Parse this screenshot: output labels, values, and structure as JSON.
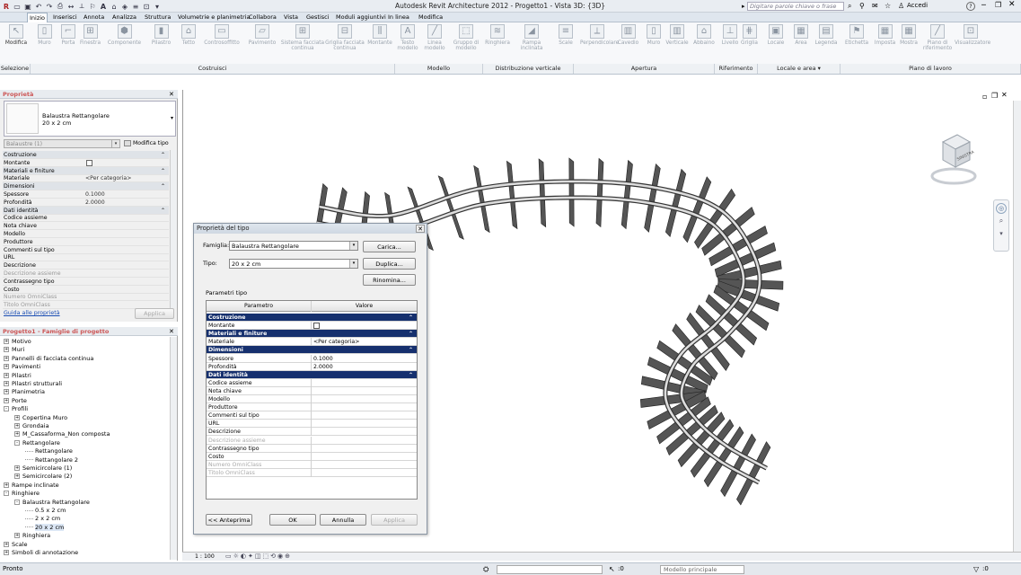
{
  "window": {
    "title": "Autodesk Revit Architecture 2012 -     Progetto1 - Vista 3D: {3D}",
    "search_placeholder": "Digitare parole chiave o frase",
    "signin": "Accedi",
    "help": "?"
  },
  "tabs": [
    "Inizio",
    "Inserisci",
    "Annota",
    "Analizza",
    "Struttura",
    "Volumetrie e planimetria",
    "Collabora",
    "Vista",
    "Gestisci",
    "Moduli aggiuntivi",
    "In linea",
    "Modifica"
  ],
  "active_tab": "Inizio",
  "ribbon": {
    "buttons": [
      "Modifica",
      "Muro",
      "Porta",
      "Finestra",
      "Componente",
      "Pilastro",
      "Tetto",
      "Controsoffitto",
      "Pavimento",
      "Sistema facciata continua",
      "Griglia facciata continua",
      "Montante",
      "Testo modello",
      "Linea modello",
      "Gruppo di modello",
      "Ringhiera",
      "Rampa inclinata",
      "Scale",
      "Perpendicolare",
      "Cavedio",
      "Muro",
      "Verticale",
      "Abbaino",
      "Livello",
      "Griglia",
      "Locale",
      "Area",
      "Legenda",
      "Etichetta",
      "Imposta",
      "Mostra",
      "Piano di riferimento",
      "Visualizzatore"
    ],
    "panels": [
      "Selezione",
      "Costruisci",
      "Modello",
      "Distribuzione verticale",
      "Apertura",
      "Riferimento",
      "Locale e area ▾",
      "Piano di lavoro"
    ]
  },
  "properties": {
    "header": "Proprietà",
    "type_name_line1": "Balaustra Rettangolare",
    "type_name_line2": "20 x 2 cm",
    "filter": "Balaustre (1)",
    "edit_type": "Modifica tipo",
    "rows": [
      {
        "k": "Costruzione",
        "v": "",
        "grp": true
      },
      {
        "k": "Montante",
        "v": "",
        "check": true
      },
      {
        "k": "Materiali e finiture",
        "v": "",
        "grp": true
      },
      {
        "k": "Materiale",
        "v": "<Per categoria>"
      },
      {
        "k": "Dimensioni",
        "v": "",
        "grp": true
      },
      {
        "k": "Spessore",
        "v": "0.1000"
      },
      {
        "k": "Profondità",
        "v": "2.0000"
      },
      {
        "k": "Dati identità",
        "v": "",
        "grp": true
      },
      {
        "k": "Codice assieme",
        "v": ""
      },
      {
        "k": "Nota chiave",
        "v": ""
      },
      {
        "k": "Modello",
        "v": ""
      },
      {
        "k": "Produttore",
        "v": ""
      },
      {
        "k": "Commenti sul tipo",
        "v": ""
      },
      {
        "k": "URL",
        "v": ""
      },
      {
        "k": "Descrizione",
        "v": ""
      },
      {
        "k": "Descrizione assieme",
        "v": "",
        "dim": true
      },
      {
        "k": "Contrassegno tipo",
        "v": ""
      },
      {
        "k": "Costo",
        "v": ""
      },
      {
        "k": "Numero OmniClass",
        "v": "",
        "dim": true
      },
      {
        "k": "Titolo OmniClass",
        "v": "",
        "dim": true
      }
    ],
    "help_link": "Guida alle proprietà",
    "apply": "Applica"
  },
  "browser": {
    "header": "Progetto1 - Famiglie di progetto",
    "nodes": [
      {
        "t": "Motivo",
        "d": 1,
        "tog": "+"
      },
      {
        "t": "Muri",
        "d": 1,
        "tog": "+"
      },
      {
        "t": "Pannelli di facciata continua",
        "d": 1,
        "tog": "+"
      },
      {
        "t": "Pavimenti",
        "d": 1,
        "tog": "+"
      },
      {
        "t": "Pilastri",
        "d": 1,
        "tog": "+"
      },
      {
        "t": "Pilastri strutturali",
        "d": 1,
        "tog": "+"
      },
      {
        "t": "Planimetria",
        "d": 1,
        "tog": "+"
      },
      {
        "t": "Porte",
        "d": 1,
        "tog": "+"
      },
      {
        "t": "Profili",
        "d": 1,
        "tog": "-"
      },
      {
        "t": "Copertina Muro",
        "d": 2,
        "tog": "+"
      },
      {
        "t": "Grondaia",
        "d": 2,
        "tog": "+"
      },
      {
        "t": "M_Cassaforma_Non composta",
        "d": 2,
        "tog": "+"
      },
      {
        "t": "Rettangolare",
        "d": 2,
        "tog": "-"
      },
      {
        "t": "Rettangolare",
        "d": 3,
        "tog": ""
      },
      {
        "t": "Rettangolare 2",
        "d": 3,
        "tog": ""
      },
      {
        "t": "Semicircolare (1)",
        "d": 2,
        "tog": "+"
      },
      {
        "t": "Semicircolare (2)",
        "d": 2,
        "tog": "+"
      },
      {
        "t": "Rampe inclinate",
        "d": 1,
        "tog": "+"
      },
      {
        "t": "Ringhiere",
        "d": 1,
        "tog": "-"
      },
      {
        "t": "Balaustra Rettangolare",
        "d": 2,
        "tog": "-"
      },
      {
        "t": "0.5 x 2 cm",
        "d": 3,
        "tog": ""
      },
      {
        "t": "2 x 2 cm",
        "d": 3,
        "tog": ""
      },
      {
        "t": "20 x 2 cm",
        "d": 3,
        "tog": "",
        "sel": true
      },
      {
        "t": "Ringhiera",
        "d": 2,
        "tog": "+"
      },
      {
        "t": "Scale",
        "d": 1,
        "tog": "+"
      },
      {
        "t": "Simboli di annotazione",
        "d": 1,
        "tog": "+"
      }
    ]
  },
  "dialog": {
    "title": "Proprietà del tipo",
    "family_label": "Famiglia:",
    "family_value": "Balaustra Rettangolare",
    "type_label": "Tipo:",
    "type_value": "20 x 2 cm",
    "load_btn": "Carica...",
    "duplicate_btn": "Duplica...",
    "rename_btn": "Rinomina...",
    "params_label": "Parametri tipo",
    "col_param": "Parametro",
    "col_value": "Valore",
    "rows": [
      {
        "k": "Costruzione",
        "v": "",
        "grp": true
      },
      {
        "k": "Montante",
        "v": "",
        "check": true
      },
      {
        "k": "Materiali e finiture",
        "v": "",
        "grp": true
      },
      {
        "k": "Materiale",
        "v": "<Per categoria>"
      },
      {
        "k": "Dimensioni",
        "v": "",
        "grp": true
      },
      {
        "k": "Spessore",
        "v": "0.1000"
      },
      {
        "k": "Profondità",
        "v": "2.0000"
      },
      {
        "k": "Dati identità",
        "v": "",
        "grp": true
      },
      {
        "k": "Codice assieme",
        "v": ""
      },
      {
        "k": "Nota chiave",
        "v": ""
      },
      {
        "k": "Modello",
        "v": ""
      },
      {
        "k": "Produttore",
        "v": ""
      },
      {
        "k": "Commenti sul tipo",
        "v": ""
      },
      {
        "k": "URL",
        "v": ""
      },
      {
        "k": "Descrizione",
        "v": ""
      },
      {
        "k": "Descrizione assieme",
        "v": "",
        "dim": true
      },
      {
        "k": "Contrassegno tipo",
        "v": ""
      },
      {
        "k": "Costo",
        "v": ""
      },
      {
        "k": "Numero OmniClass",
        "v": "",
        "dim": true
      },
      {
        "k": "Titolo OmniClass",
        "v": "",
        "dim": true
      }
    ],
    "preview_btn": "<< Anteprima",
    "ok_btn": "OK",
    "cancel_btn": "Annulla",
    "apply_btn": "Applica"
  },
  "viewcube": {
    "face": "SINISTRA"
  },
  "view_control": {
    "scale": "1 : 100"
  },
  "status": {
    "text": "Pronto",
    "zero1": ":0",
    "model": "Modello principale",
    "zero2": ":0"
  }
}
